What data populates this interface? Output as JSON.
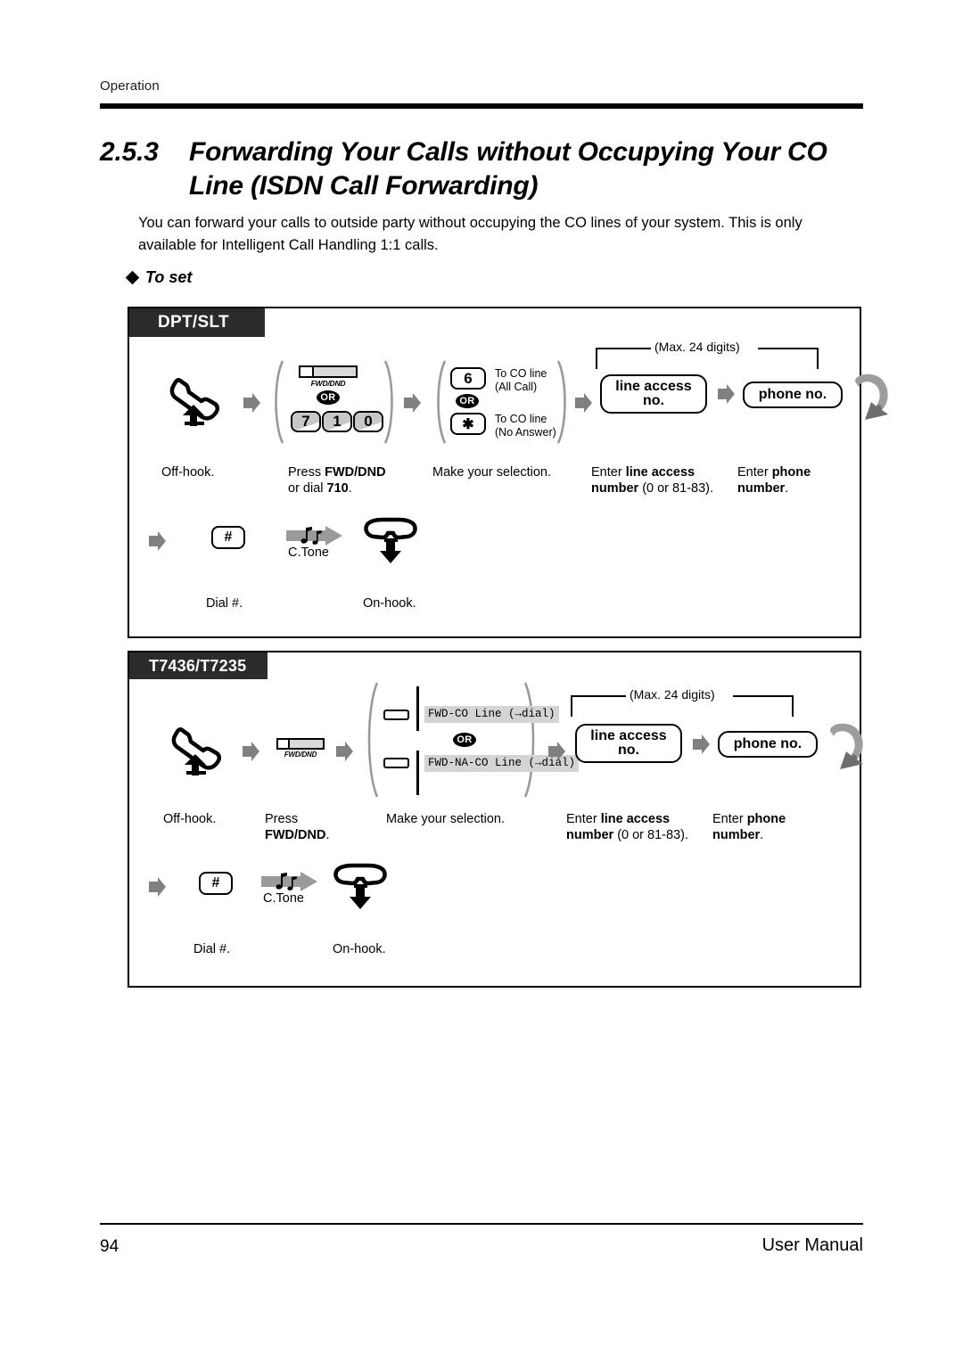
{
  "header": {
    "label": "Operation"
  },
  "title": {
    "number": "2.5.3",
    "line1": "Forwarding Your Calls without Occupying Your CO",
    "line2": "Line (ISDN Call Forwarding)"
  },
  "intro": "You can forward your calls to outside party without occupying the CO lines of your system. This is only available for Intelligent Call Handling 1:1 calls.",
  "subhead": {
    "label": "To set"
  },
  "common": {
    "or": "OR",
    "max_digits": "(Max. 24 digits)",
    "line_access_line1": "line access",
    "line_access_line2": "no.",
    "phone_no": "phone no.",
    "hash": "#",
    "ctone": "C.Tone",
    "fwd_dnd_btn_label": "FWD/DND"
  },
  "dpt_block": {
    "tab": "DPT/SLT",
    "keys": {
      "seven": "7",
      "one": "1",
      "zero": "0",
      "six": "6",
      "star": "✱"
    },
    "select_labels": {
      "all_call_line1": "To CO line",
      "all_call_line2": "(All Call)",
      "no_answer_line1": "To CO line",
      "no_answer_line2": "(No Answer)"
    },
    "captions": {
      "offhook": "Off-hook.",
      "press_fwd_l1_a": "Press ",
      "press_fwd_l1_b": "FWD/DND",
      "press_fwd_l2_a": "or dial ",
      "press_fwd_l2_b": "710",
      "press_fwd_l2_c": ".",
      "selection": "Make your selection.",
      "line_access_l1_a": "Enter ",
      "line_access_l1_b": "line access",
      "line_access_l2_b": "number",
      "line_access_l2_c": " (0 or 81-83).",
      "phone_l1_a": "Enter ",
      "phone_l1_b": "phone",
      "phone_l2_b": "number",
      "phone_l2_c": ".",
      "dial_hash": "Dial #.",
      "onhook": "On-hook."
    }
  },
  "t74_block": {
    "tab": "T7436/T7235",
    "display_options": {
      "option1": "FWD-CO Line (→dial)",
      "option2": "FWD-NA-CO Line (→dial)"
    },
    "captions": {
      "offhook": "Off-hook.",
      "press_l1": "Press",
      "press_l2": "FWD/DND",
      "press_l2_period": ".",
      "selection": "Make your selection.",
      "line_access_l1_a": "Enter ",
      "line_access_l1_b": "line access",
      "line_access_l2_b": "number",
      "line_access_l2_c": " (0 or 81-83).",
      "phone_l1_a": "Enter ",
      "phone_l1_b": "phone",
      "phone_l2_b": "number",
      "phone_l2_c": ".",
      "dial_hash": "Dial #.",
      "onhook": "On-hook."
    }
  },
  "footer": {
    "page_number": "94",
    "manual_title": "User Manual"
  },
  "colors": {
    "tab_bg": "#2b2b2b",
    "arrow_gray": "#808080",
    "lcd_gray": "#d4d4d4",
    "key_shine": "#c8c8c8"
  }
}
